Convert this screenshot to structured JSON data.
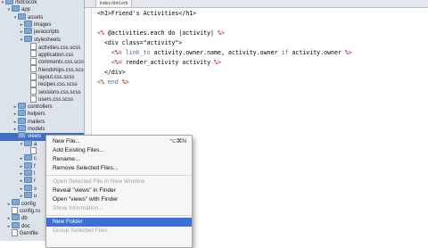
{
  "sidebar": {
    "items": [
      {
        "label": "rbdcocok",
        "kind": "folder",
        "indent": 0,
        "disc": "▾"
      },
      {
        "label": "app",
        "kind": "folder",
        "indent": 1,
        "disc": "▾"
      },
      {
        "label": "assets",
        "kind": "folder",
        "indent": 2,
        "disc": "▾"
      },
      {
        "label": "images",
        "kind": "folder",
        "indent": 3,
        "disc": "▸"
      },
      {
        "label": "javascripts",
        "kind": "folder",
        "indent": 3,
        "disc": "▸"
      },
      {
        "label": "stylesheets",
        "kind": "folder",
        "indent": 3,
        "disc": "▾"
      },
      {
        "label": "activities.css.scss",
        "kind": "file",
        "indent": 4,
        "disc": ""
      },
      {
        "label": "application.css",
        "kind": "file",
        "indent": 4,
        "disc": ""
      },
      {
        "label": "comments.css.scss",
        "kind": "file",
        "indent": 4,
        "disc": ""
      },
      {
        "label": "friendships.css.scss",
        "kind": "file",
        "indent": 4,
        "disc": ""
      },
      {
        "label": "layout.css.scss",
        "kind": "file",
        "indent": 4,
        "disc": ""
      },
      {
        "label": "recipes.css.scss",
        "kind": "file",
        "indent": 4,
        "disc": ""
      },
      {
        "label": "sessions.css.scss",
        "kind": "file",
        "indent": 4,
        "disc": ""
      },
      {
        "label": "users.css.scss",
        "kind": "file",
        "indent": 4,
        "disc": ""
      },
      {
        "label": "controllers",
        "kind": "folder",
        "indent": 2,
        "disc": "▸"
      },
      {
        "label": "helpers",
        "kind": "folder",
        "indent": 2,
        "disc": "▸"
      },
      {
        "label": "mailers",
        "kind": "folder",
        "indent": 2,
        "disc": "▸"
      },
      {
        "label": "models",
        "kind": "folder",
        "indent": 2,
        "disc": "▸"
      },
      {
        "label": "views",
        "kind": "folder",
        "indent": 2,
        "disc": "▾",
        "selected": true
      },
      {
        "label": "a",
        "kind": "folder",
        "indent": 3,
        "disc": "▾"
      },
      {
        "label": "",
        "kind": "file",
        "indent": 4,
        "disc": ""
      },
      {
        "label": "c",
        "kind": "folder",
        "indent": 3,
        "disc": "▸"
      },
      {
        "label": "f",
        "kind": "folder",
        "indent": 3,
        "disc": "▸"
      },
      {
        "label": "l",
        "kind": "folder",
        "indent": 3,
        "disc": "▸"
      },
      {
        "label": "r",
        "kind": "folder",
        "indent": 3,
        "disc": "▸"
      },
      {
        "label": "s",
        "kind": "folder",
        "indent": 3,
        "disc": "▸"
      },
      {
        "label": "u",
        "kind": "folder",
        "indent": 3,
        "disc": "▸"
      },
      {
        "label": "config",
        "kind": "folder",
        "indent": 1,
        "disc": "▸"
      },
      {
        "label": "config.ru",
        "kind": "file",
        "indent": 1,
        "disc": ""
      },
      {
        "label": "db",
        "kind": "folder",
        "indent": 1,
        "disc": "▸"
      },
      {
        "label": "doc",
        "kind": "folder",
        "indent": 1,
        "disc": "▸"
      },
      {
        "label": "Gemfile",
        "kind": "file",
        "indent": 1,
        "disc": ""
      }
    ]
  },
  "editor": {
    "tab_label": "index.html.erb",
    "lines": [
      [
        {
          "t": "<h1>Friend's Activities</h1>",
          "c": "#000000"
        }
      ],
      [
        {
          "t": "",
          "c": "#000000"
        }
      ],
      [
        {
          "t": "<% ",
          "c": "#a31515"
        },
        {
          "t": "@activities.each do ",
          "c": "#000000"
        },
        {
          "t": "|activity| ",
          "c": "#000000"
        },
        {
          "t": "%>",
          "c": "#a31515"
        }
      ],
      [
        {
          "t": "  <div class=\"activity\">",
          "c": "#000000"
        }
      ],
      [
        {
          "t": "    <%= ",
          "c": "#a31515"
        },
        {
          "t": "link_to ",
          "c": "#4f6b9a"
        },
        {
          "t": "activity.owner.name, activity.owner ",
          "c": "#000000"
        },
        {
          "t": "if ",
          "c": "#4f6b9a"
        },
        {
          "t": "activity.owner ",
          "c": "#000000"
        },
        {
          "t": "%>",
          "c": "#a31515"
        }
      ],
      [
        {
          "t": "    <%= ",
          "c": "#a31515"
        },
        {
          "t": "render_activity activity ",
          "c": "#000000"
        },
        {
          "t": "%>",
          "c": "#a31515"
        }
      ],
      [
        {
          "t": "  </div>",
          "c": "#000000"
        }
      ],
      [
        {
          "t": "<% ",
          "c": "#a31515"
        },
        {
          "t": "end ",
          "c": "#4f6b9a"
        },
        {
          "t": "%>",
          "c": "#a31515"
        }
      ]
    ]
  },
  "context_menu": {
    "groups": [
      [
        {
          "label": "New File...",
          "shortcut": "⌥⌘N",
          "disabled": false
        },
        {
          "label": "Add Existing Files...",
          "disabled": false
        },
        {
          "label": "Rename...",
          "disabled": false
        },
        {
          "label": "Remove Selected Files...",
          "disabled": false
        }
      ],
      [
        {
          "label": "Open Selected File in New Window",
          "disabled": true
        },
        {
          "label": "Reveal \"views\" in Finder",
          "disabled": false
        },
        {
          "label": "Open \"views\" with Finder",
          "disabled": false
        },
        {
          "label": "Show Information...",
          "disabled": true
        }
      ],
      [
        {
          "label": "New Folder",
          "disabled": false,
          "highlighted": true
        },
        {
          "label": "Group Selected Files",
          "disabled": true
        }
      ]
    ]
  }
}
